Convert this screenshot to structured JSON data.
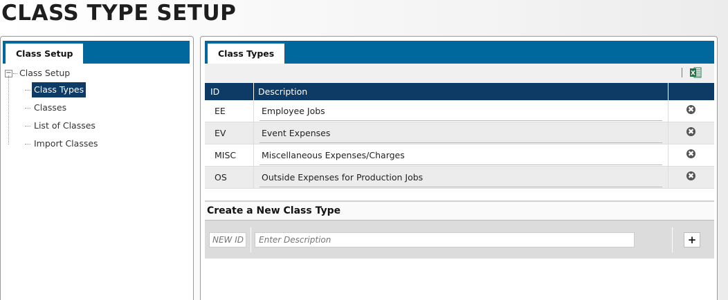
{
  "page": {
    "title": "CLASS TYPE SETUP"
  },
  "left_panel": {
    "tab_label": "Class Setup",
    "tree": {
      "root_label": "Class Setup",
      "items": [
        {
          "label": "Class Types",
          "selected": true
        },
        {
          "label": "Classes",
          "selected": false
        },
        {
          "label": "List of Classes",
          "selected": false
        },
        {
          "label": "Import Classes",
          "selected": false
        }
      ]
    }
  },
  "right_panel": {
    "tab_label": "Class Types",
    "toolbar": {
      "export_icon": "excel-export-icon",
      "excel_icon_letter": "X"
    },
    "grid": {
      "columns": [
        "ID",
        "Description",
        ""
      ],
      "rows": [
        {
          "id": "EE",
          "description": "Employee Jobs",
          "delete_icon": "✖"
        },
        {
          "id": "EV",
          "description": "Event Expenses",
          "delete_icon": "✖"
        },
        {
          "id": "MISC",
          "description": "Miscellaneous Expenses/Charges",
          "delete_icon": "✖"
        },
        {
          "id": "OS",
          "description": "Outside Expenses for Production Jobs",
          "delete_icon": "✖"
        }
      ]
    },
    "create": {
      "title": "Create a New Class Type",
      "id_placeholder": "NEW ID",
      "description_placeholder": "Enter Description",
      "add_label": "+"
    }
  },
  "colors": {
    "tab_bar": "#00689c",
    "header_navy": "#0e3a66",
    "excel_green": "#1e7145"
  }
}
